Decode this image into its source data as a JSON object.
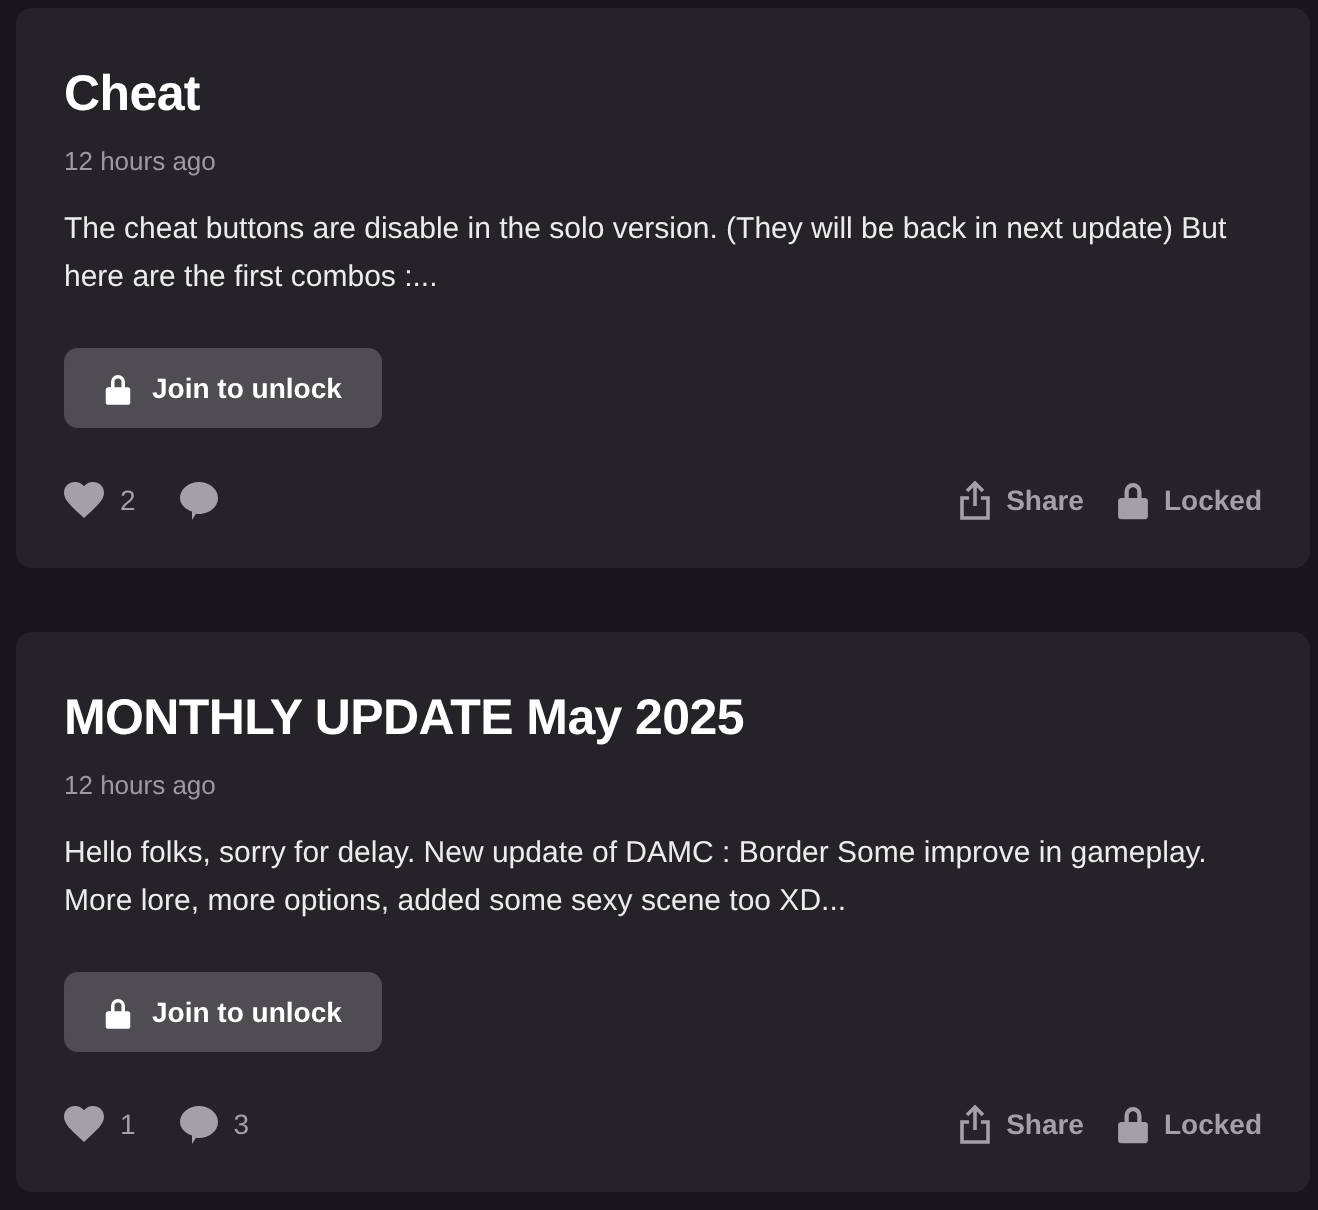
{
  "posts": [
    {
      "title": "Cheat",
      "time": "12 hours ago",
      "excerpt": "The cheat buttons are disable in the solo version. (They will be back in next update) But here are the first combos :...",
      "unlock_label": "Join to unlock",
      "likes": "2",
      "share_label": "Share",
      "lock_label": "Locked"
    },
    {
      "title": "MONTHLY UPDATE May 2025",
      "time": "12 hours ago",
      "excerpt": "Hello folks, sorry for delay. New update of DAMC : Border Some improve in gameplay. More lore, more options, added some sexy scene too XD...",
      "unlock_label": "Join to unlock",
      "likes": "1",
      "comments": "3",
      "share_label": "Share",
      "lock_label": "Locked"
    }
  ]
}
